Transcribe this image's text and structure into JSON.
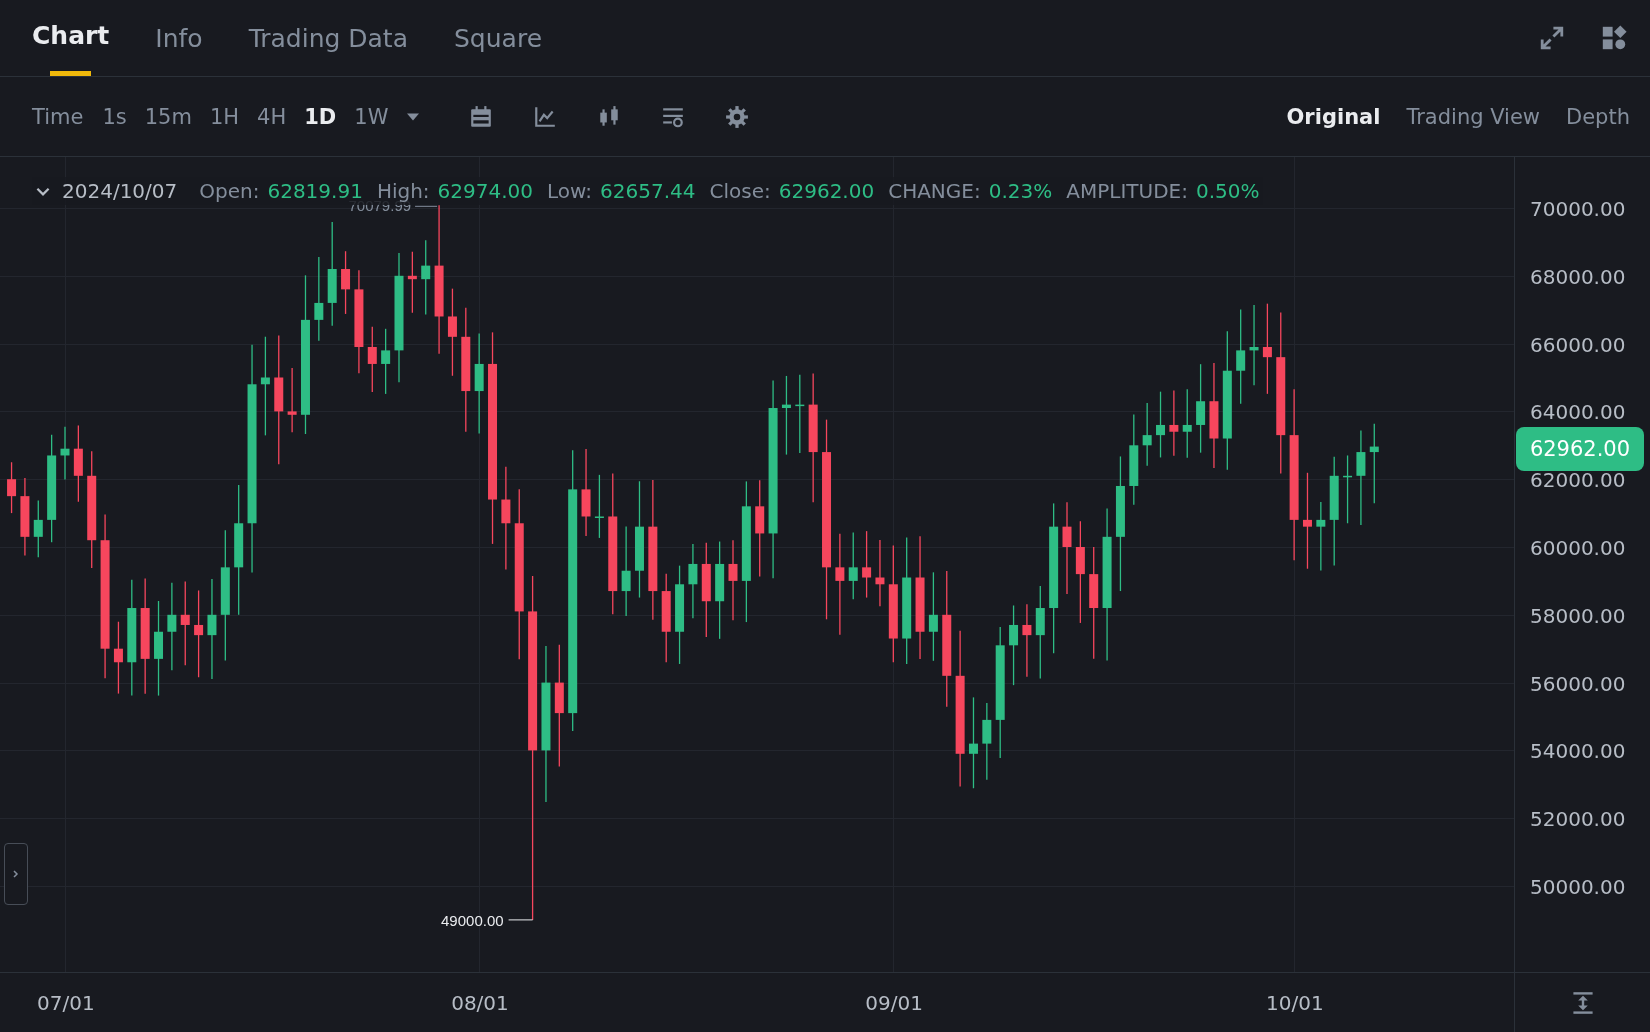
{
  "tabs": [
    {
      "label": "Chart",
      "selected": true
    },
    {
      "label": "Info",
      "selected": false
    },
    {
      "label": "Trading Data",
      "selected": false
    },
    {
      "label": "Square",
      "selected": false
    }
  ],
  "intervals": [
    {
      "label": "Time",
      "kind": "label"
    },
    {
      "label": "1s",
      "kind": "option",
      "selected": false
    },
    {
      "label": "15m",
      "kind": "option",
      "selected": false
    },
    {
      "label": "1H",
      "kind": "option",
      "selected": false
    },
    {
      "label": "4H",
      "kind": "option",
      "selected": false
    },
    {
      "label": "1D",
      "kind": "option",
      "selected": true
    },
    {
      "label": "1W",
      "kind": "option",
      "selected": false
    }
  ],
  "view_modes": [
    {
      "label": "Original",
      "selected": true
    },
    {
      "label": "Trading View",
      "selected": false
    },
    {
      "label": "Depth",
      "selected": false
    }
  ],
  "ohlc": {
    "date": "2024/10/07",
    "fields": [
      {
        "label": "Open:",
        "value": "62819.91"
      },
      {
        "label": "High:",
        "value": "62974.00"
      },
      {
        "label": "Low:",
        "value": "62657.44"
      },
      {
        "label": "Close:",
        "value": "62962.00"
      },
      {
        "label": "CHANGE:",
        "value": "0.23%"
      },
      {
        "label": "AMPLITUDE:",
        "value": "0.50%"
      }
    ]
  },
  "price_axis": [
    "70000.00",
    "68000.00",
    "66000.00",
    "64000.00",
    "62000.00",
    "60000.00",
    "58000.00",
    "56000.00",
    "54000.00",
    "52000.00",
    "50000.00"
  ],
  "current_price": "62962.00",
  "annotations": {
    "high": "70079.99",
    "low": "49000.00"
  },
  "date_axis": [
    "07/01",
    "08/01",
    "09/01",
    "10/01"
  ]
}
